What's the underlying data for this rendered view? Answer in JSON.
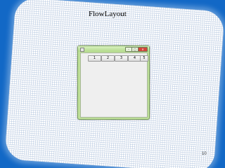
{
  "slide": {
    "title": "FlowLayout",
    "page_number": "10"
  },
  "window": {
    "controls": {
      "minimize": "–",
      "maximize": "□",
      "close": "✕"
    },
    "buttons": [
      {
        "label": "1"
      },
      {
        "label": "2"
      },
      {
        "label": "3"
      },
      {
        "label": "4"
      },
      {
        "label": "5"
      }
    ]
  },
  "colors": {
    "background": "#1268c6",
    "window_frame": "#bfe09a",
    "close_button": "#d2463a"
  }
}
